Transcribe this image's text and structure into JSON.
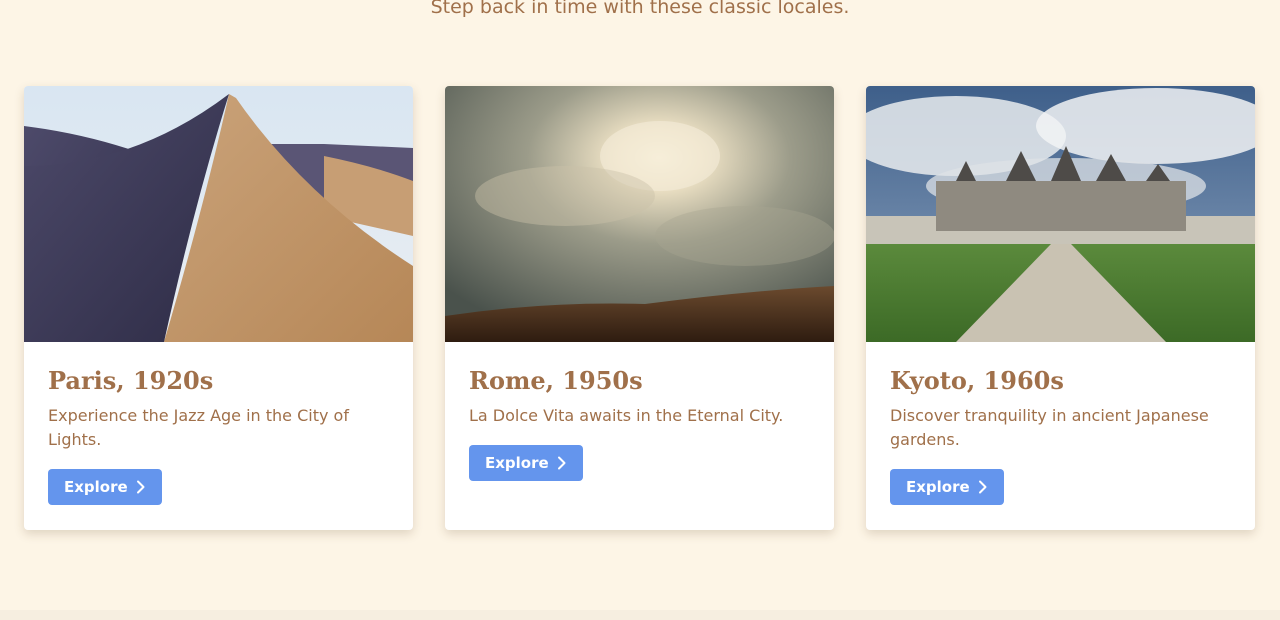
{
  "header": {
    "subtitle": "Step back in time with these classic locales."
  },
  "destinations": [
    {
      "title": "Paris, 1920s",
      "description": "Experience the Jazz Age in the City of Lights.",
      "button_label": "Explore",
      "button_icon": "chevron-right-icon",
      "image_subject": "desert-sand-dune"
    },
    {
      "title": "Rome, 1950s",
      "description": "La Dolce Vita awaits in the Eternal City.",
      "button_label": "Explore",
      "button_icon": "chevron-right-icon",
      "image_subject": "sunburst-clouds-over-dunes"
    },
    {
      "title": "Kyoto, 1960s",
      "description": "Discover tranquility in ancient Japanese gardens.",
      "button_label": "Explore",
      "button_icon": "chevron-right-icon",
      "image_subject": "chateau-with-path-and-lawn"
    }
  ],
  "colors": {
    "background": "#fdf5e6",
    "text_accent": "#a0704a",
    "button": "#6495ed",
    "button_text": "#ffffff",
    "card": "#ffffff"
  }
}
